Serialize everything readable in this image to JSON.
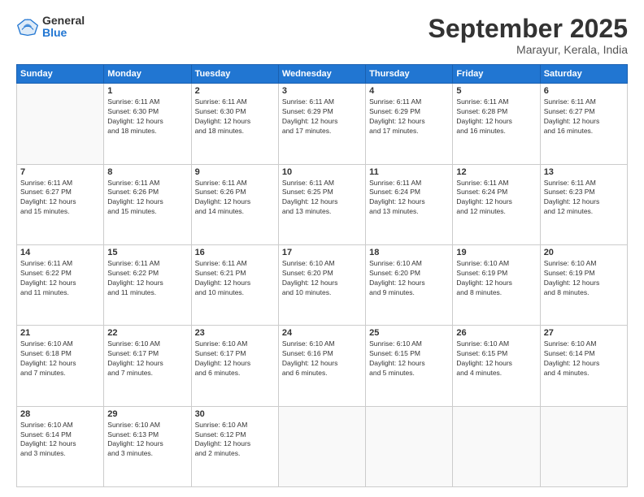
{
  "logo": {
    "general": "General",
    "blue": "Blue"
  },
  "header": {
    "month": "September 2025",
    "location": "Marayur, Kerala, India"
  },
  "weekdays": [
    "Sunday",
    "Monday",
    "Tuesday",
    "Wednesday",
    "Thursday",
    "Friday",
    "Saturday"
  ],
  "weeks": [
    [
      {
        "day": "",
        "text": ""
      },
      {
        "day": "1",
        "text": "Sunrise: 6:11 AM\nSunset: 6:30 PM\nDaylight: 12 hours\nand 18 minutes."
      },
      {
        "day": "2",
        "text": "Sunrise: 6:11 AM\nSunset: 6:30 PM\nDaylight: 12 hours\nand 18 minutes."
      },
      {
        "day": "3",
        "text": "Sunrise: 6:11 AM\nSunset: 6:29 PM\nDaylight: 12 hours\nand 17 minutes."
      },
      {
        "day": "4",
        "text": "Sunrise: 6:11 AM\nSunset: 6:29 PM\nDaylight: 12 hours\nand 17 minutes."
      },
      {
        "day": "5",
        "text": "Sunrise: 6:11 AM\nSunset: 6:28 PM\nDaylight: 12 hours\nand 16 minutes."
      },
      {
        "day": "6",
        "text": "Sunrise: 6:11 AM\nSunset: 6:27 PM\nDaylight: 12 hours\nand 16 minutes."
      }
    ],
    [
      {
        "day": "7",
        "text": "Sunrise: 6:11 AM\nSunset: 6:27 PM\nDaylight: 12 hours\nand 15 minutes."
      },
      {
        "day": "8",
        "text": "Sunrise: 6:11 AM\nSunset: 6:26 PM\nDaylight: 12 hours\nand 15 minutes."
      },
      {
        "day": "9",
        "text": "Sunrise: 6:11 AM\nSunset: 6:26 PM\nDaylight: 12 hours\nand 14 minutes."
      },
      {
        "day": "10",
        "text": "Sunrise: 6:11 AM\nSunset: 6:25 PM\nDaylight: 12 hours\nand 13 minutes."
      },
      {
        "day": "11",
        "text": "Sunrise: 6:11 AM\nSunset: 6:24 PM\nDaylight: 12 hours\nand 13 minutes."
      },
      {
        "day": "12",
        "text": "Sunrise: 6:11 AM\nSunset: 6:24 PM\nDaylight: 12 hours\nand 12 minutes."
      },
      {
        "day": "13",
        "text": "Sunrise: 6:11 AM\nSunset: 6:23 PM\nDaylight: 12 hours\nand 12 minutes."
      }
    ],
    [
      {
        "day": "14",
        "text": "Sunrise: 6:11 AM\nSunset: 6:22 PM\nDaylight: 12 hours\nand 11 minutes."
      },
      {
        "day": "15",
        "text": "Sunrise: 6:11 AM\nSunset: 6:22 PM\nDaylight: 12 hours\nand 11 minutes."
      },
      {
        "day": "16",
        "text": "Sunrise: 6:11 AM\nSunset: 6:21 PM\nDaylight: 12 hours\nand 10 minutes."
      },
      {
        "day": "17",
        "text": "Sunrise: 6:10 AM\nSunset: 6:20 PM\nDaylight: 12 hours\nand 10 minutes."
      },
      {
        "day": "18",
        "text": "Sunrise: 6:10 AM\nSunset: 6:20 PM\nDaylight: 12 hours\nand 9 minutes."
      },
      {
        "day": "19",
        "text": "Sunrise: 6:10 AM\nSunset: 6:19 PM\nDaylight: 12 hours\nand 8 minutes."
      },
      {
        "day": "20",
        "text": "Sunrise: 6:10 AM\nSunset: 6:19 PM\nDaylight: 12 hours\nand 8 minutes."
      }
    ],
    [
      {
        "day": "21",
        "text": "Sunrise: 6:10 AM\nSunset: 6:18 PM\nDaylight: 12 hours\nand 7 minutes."
      },
      {
        "day": "22",
        "text": "Sunrise: 6:10 AM\nSunset: 6:17 PM\nDaylight: 12 hours\nand 7 minutes."
      },
      {
        "day": "23",
        "text": "Sunrise: 6:10 AM\nSunset: 6:17 PM\nDaylight: 12 hours\nand 6 minutes."
      },
      {
        "day": "24",
        "text": "Sunrise: 6:10 AM\nSunset: 6:16 PM\nDaylight: 12 hours\nand 6 minutes."
      },
      {
        "day": "25",
        "text": "Sunrise: 6:10 AM\nSunset: 6:15 PM\nDaylight: 12 hours\nand 5 minutes."
      },
      {
        "day": "26",
        "text": "Sunrise: 6:10 AM\nSunset: 6:15 PM\nDaylight: 12 hours\nand 4 minutes."
      },
      {
        "day": "27",
        "text": "Sunrise: 6:10 AM\nSunset: 6:14 PM\nDaylight: 12 hours\nand 4 minutes."
      }
    ],
    [
      {
        "day": "28",
        "text": "Sunrise: 6:10 AM\nSunset: 6:14 PM\nDaylight: 12 hours\nand 3 minutes."
      },
      {
        "day": "29",
        "text": "Sunrise: 6:10 AM\nSunset: 6:13 PM\nDaylight: 12 hours\nand 3 minutes."
      },
      {
        "day": "30",
        "text": "Sunrise: 6:10 AM\nSunset: 6:12 PM\nDaylight: 12 hours\nand 2 minutes."
      },
      {
        "day": "",
        "text": ""
      },
      {
        "day": "",
        "text": ""
      },
      {
        "day": "",
        "text": ""
      },
      {
        "day": "",
        "text": ""
      }
    ]
  ]
}
